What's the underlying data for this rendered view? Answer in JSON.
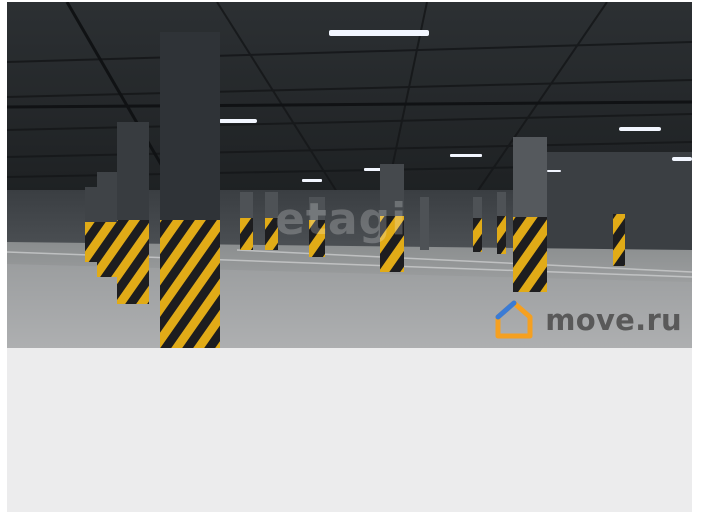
{
  "listing_photo": {
    "watermarks": {
      "etagi": "etagi",
      "move": "move.ru"
    },
    "colors": {
      "move_text": "#595959",
      "house_orange": "#f5a020",
      "house_blue": "#3a7bd5",
      "hazard_yellow": "#e8b21a"
    }
  }
}
